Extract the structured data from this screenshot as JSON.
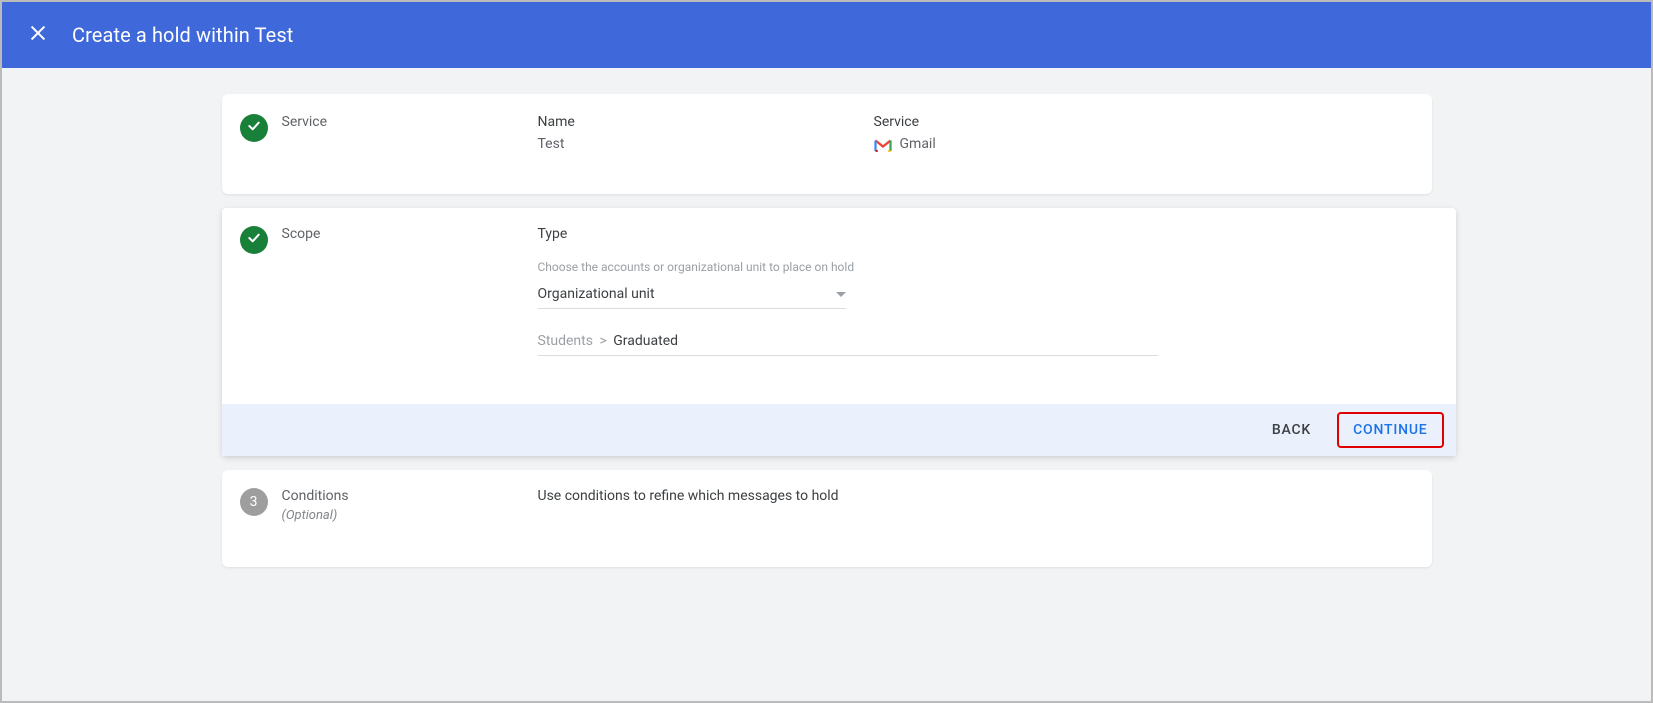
{
  "header": {
    "title": "Create a hold within Test"
  },
  "steps": {
    "service": {
      "label": "Service",
      "name_label": "Name",
      "name_value": "Test",
      "service_label": "Service",
      "service_value": "Gmail"
    },
    "scope": {
      "label": "Scope",
      "type_label": "Type",
      "help_text": "Choose the accounts or organizational unit to place on hold",
      "dropdown_value": "Organizational unit",
      "breadcrumb_parent": "Students",
      "breadcrumb_sep": ">",
      "breadcrumb_child": "Graduated"
    },
    "conditions": {
      "number": "3",
      "label": "Conditions",
      "optional": "(Optional)",
      "description": "Use conditions to refine which messages to hold"
    }
  },
  "actions": {
    "back": "BACK",
    "continue": "CONTINUE"
  }
}
